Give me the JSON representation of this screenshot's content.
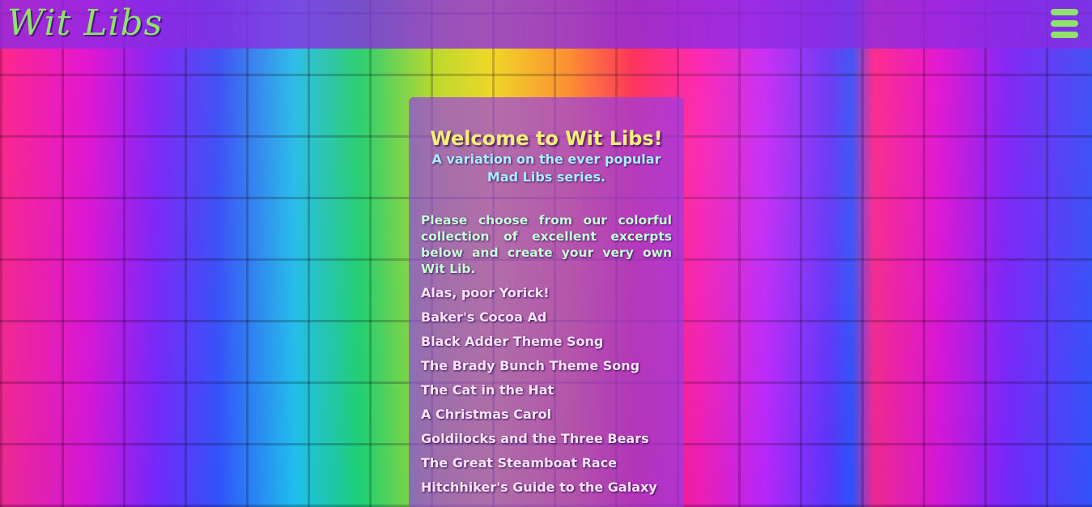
{
  "brand": {
    "name": "Wit Libs",
    "accent_color": "#8fe36b"
  },
  "nav": {
    "menu_icon": "hamburger-menu-icon"
  },
  "panel": {
    "title": "Welcome to Wit Libs!",
    "subtitle": "A variation on the ever popular Mad Libs series.",
    "intro": "Please choose from our colorful collection of excellent excerpts below and create your very own Wit Lib.",
    "excerpts": [
      "Alas, poor Yorick!",
      "Baker's Cocoa Ad",
      "Black Adder Theme Song",
      "The Brady Bunch Theme Song",
      "The Cat in the Hat",
      "A Christmas Carol",
      "Goldilocks and the Three Bears",
      "The Great Steamboat Race",
      "Hitchhiker's Guide to the Galaxy"
    ]
  }
}
